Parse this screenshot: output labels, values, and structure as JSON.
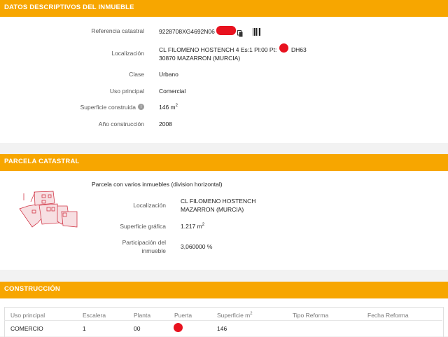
{
  "descriptivos": {
    "header": "DATOS DESCRIPTIVOS DEL INMUEBLE",
    "ref_label": "Referencia catastral",
    "ref_value": "9228708XG4692N06",
    "loc_label": "Localización",
    "loc_line1a": "CL FILOMENO HOSTENCH 4 Es:1 Pl:00 Pt:",
    "loc_line1b": "DH63",
    "loc_line2": "30870 MAZARRON (MURCIA)",
    "clase_label": "Clase",
    "clase_value": "Urbano",
    "uso_label": "Uso principal",
    "uso_value": "Comercial",
    "superficie_label": "Superficie construida",
    "superficie_value": "146 m",
    "superficie_unit": "2",
    "anio_label": "Año construcción",
    "anio_value": "2008",
    "icons": [
      "copy-icon",
      "barcode-icon",
      "info-icon"
    ]
  },
  "parcela": {
    "header": "PARCELA CATASTRAL",
    "description": "Parcela con varios inmuebles (division horizontal)",
    "loc_label": "Localización",
    "loc_line1": "CL FILOMENO HOSTENCH",
    "loc_line2": "MAZARRON (MURCIA)",
    "sup_label": "Superficie gráfica",
    "sup_value": "1.217 m",
    "sup_unit": "2",
    "part_label1": "Participación del",
    "part_label2": "inmueble",
    "part_value": "3,060000 %"
  },
  "construccion": {
    "header": "CONSTRUCCIÓN",
    "columns": [
      "Uso principal",
      "Escalera",
      "Planta",
      "Puerta",
      "Superficie m",
      "Tipo Reforma",
      "Fecha Reforma"
    ],
    "sup_unit": "2",
    "row": [
      "COMERCIO",
      "1",
      "00",
      "",
      "146",
      "",
      ""
    ]
  },
  "colors": {
    "header": "#f7a600",
    "redaction": "#e8121f",
    "plot_outline": "#d23a4a",
    "plot_fill": "#f7dfe2"
  }
}
